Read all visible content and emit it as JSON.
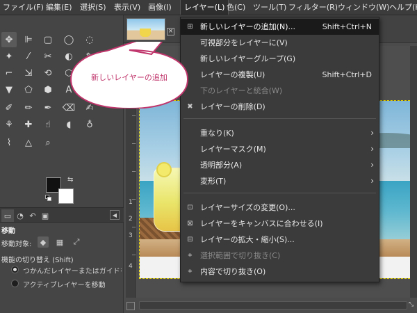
{
  "menubar": {
    "items": [
      {
        "label": "ファイル(F)"
      },
      {
        "label": "編集(E)"
      },
      {
        "label": "選択(S)"
      },
      {
        "label": "表示(V)"
      },
      {
        "label": "画像(I)"
      },
      {
        "label": "レイヤー(L)",
        "active": true
      },
      {
        "label": "色(C)"
      },
      {
        "label": "ツール(T)"
      },
      {
        "label": "フィルター(R)"
      },
      {
        "label": "ウィンドウ(W)"
      },
      {
        "label": "ヘルプ(H)"
      }
    ]
  },
  "toolbox": {
    "tool_icons": [
      "move-icon",
      "align-icon",
      "rect-select-icon",
      "ellipse-select-icon",
      "free-select-icon",
      "fuzzy-select-icon",
      "crop-icon",
      "unified-transform-icon",
      "warp-transform-icon",
      "cage-transform-icon",
      "flip-icon",
      "perspective-icon",
      "text-icon",
      "bucket-fill-icon",
      "gradient-icon",
      "paintbrush-icon",
      "eraser-icon",
      "airbrush-icon",
      "ink-icon",
      "clone-icon",
      "heal-icon",
      "smudge-icon",
      "dodge-icon",
      "blur-icon",
      "color-picker-icon",
      "measure-icon",
      "zoom-icon"
    ]
  },
  "dock": {
    "tabs": [
      "tool-options",
      "device-status",
      "undo-history",
      "images"
    ]
  },
  "tool_options": {
    "title": "移動",
    "move_target_label": "移動対象:",
    "toggle_label": "機能の切り替え (Shift)",
    "radio_options": [
      {
        "label": "つかんだレイヤーまたはガイドを移動",
        "selected": true
      },
      {
        "label": "アクティブレイヤーを移動",
        "selected": false
      }
    ]
  },
  "ruler": {
    "labels": [
      "1",
      "2",
      "3",
      "4"
    ]
  },
  "layer_menu": {
    "items": [
      {
        "label": "新しいレイヤーの追加(N)...",
        "shortcut": "Shift+Ctrl+N",
        "icon": "new-layer-icon",
        "highlight": true
      },
      {
        "label": "可視部分をレイヤーに(V)",
        "shortcut": "",
        "icon": ""
      },
      {
        "label": "新しいレイヤーグループ(G)",
        "shortcut": "",
        "icon": ""
      },
      {
        "label": "レイヤーの複製(U)",
        "shortcut": "Shift+Ctrl+D",
        "icon": ""
      },
      {
        "label": "下のレイヤーと統合(W)",
        "shortcut": "",
        "icon": "",
        "disabled": true
      },
      {
        "label": "レイヤーの削除(D)",
        "shortcut": "",
        "icon": "delete-icon"
      },
      {
        "label": "重なり(K)",
        "submenu": true
      },
      {
        "label": "レイヤーマスク(M)",
        "submenu": true
      },
      {
        "label": "透明部分(A)",
        "submenu": true
      },
      {
        "label": "変形(T)",
        "submenu": true
      },
      {
        "label": "レイヤーサイズの変更(O)...",
        "icon": "layer-size-icon"
      },
      {
        "label": "レイヤーをキャンバスに合わせる(I)",
        "icon": "fit-canvas-icon"
      },
      {
        "label": "レイヤーの拡大・縮小(S)...",
        "icon": "scale-layer-icon"
      },
      {
        "label": "選択範囲で切り抜き(C)",
        "icon": "crop-to-selection-icon",
        "disabled": true
      },
      {
        "label": "内容で切り抜き(O)",
        "icon": "crop-to-content-icon"
      }
    ]
  },
  "callout": {
    "text": "新しいレイヤーの追加",
    "color": "#c0356b"
  }
}
